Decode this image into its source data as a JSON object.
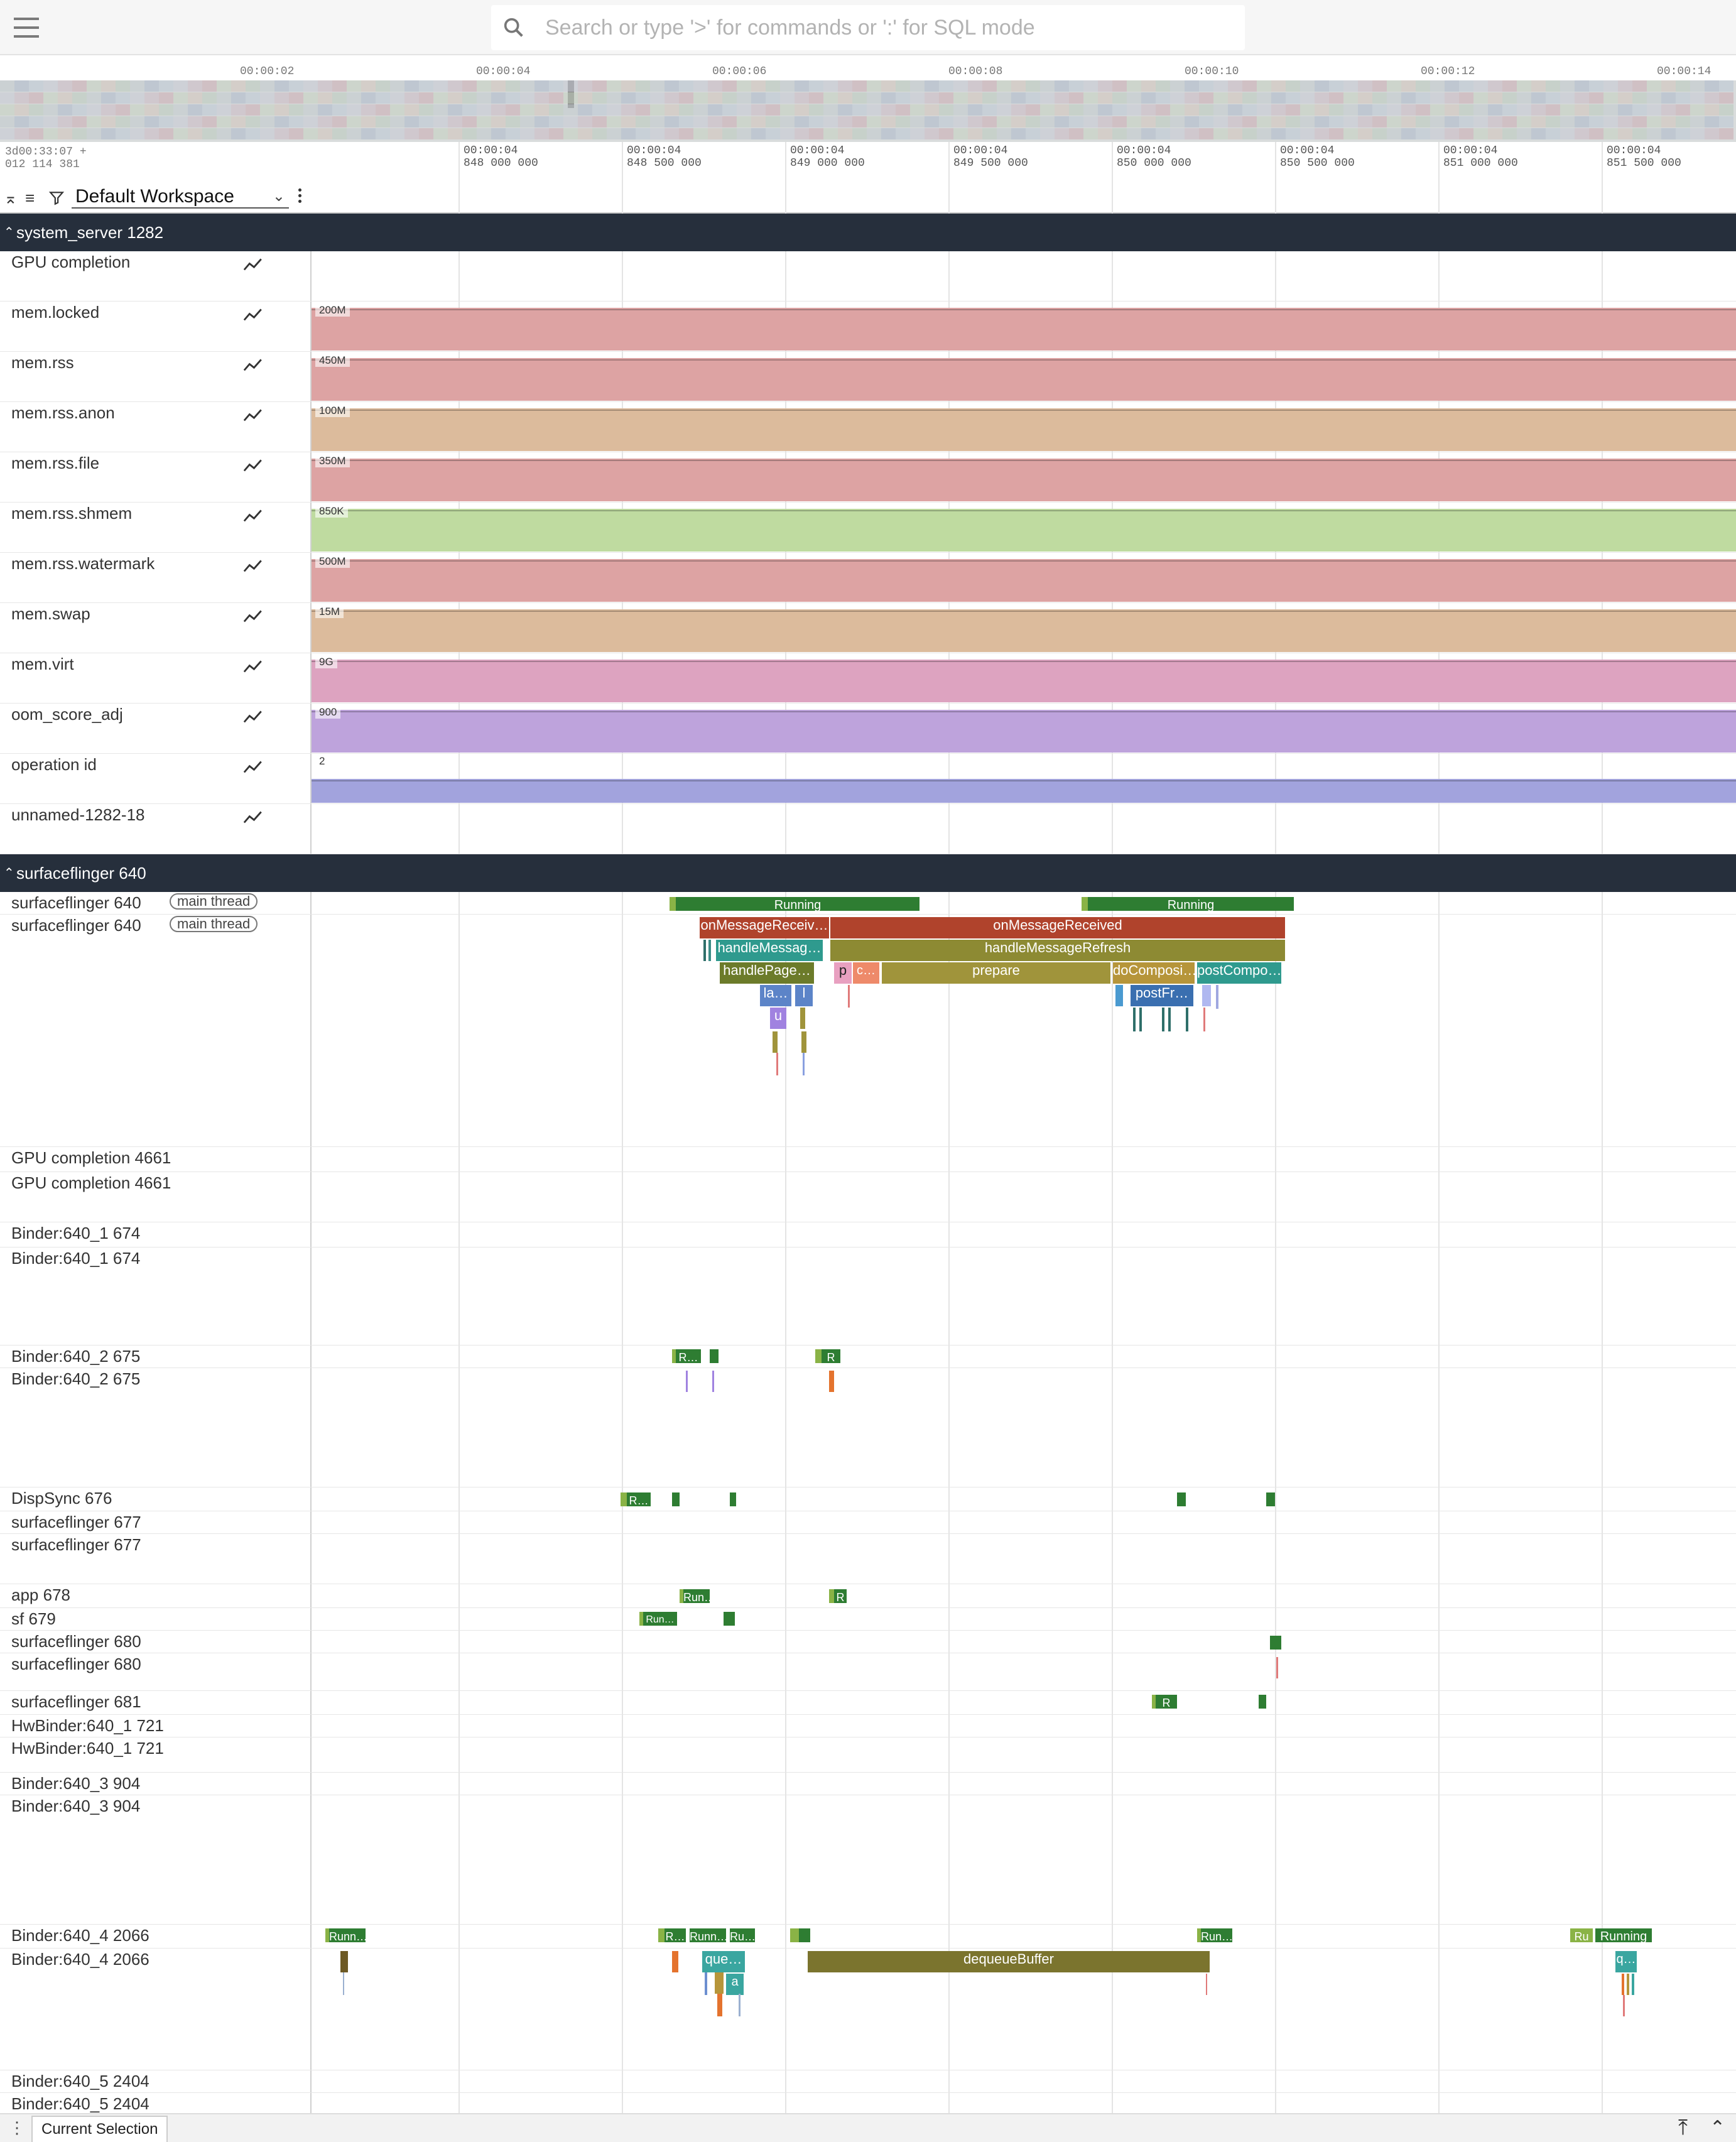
{
  "topbar": {
    "search_placeholder": "Search or type '>' for commands or ':' for SQL mode"
  },
  "timeline": {
    "ticks": [
      "00:00:02",
      "00:00:04",
      "00:00:06",
      "00:00:08",
      "00:00:10",
      "00:00:12",
      "00:00:14"
    ]
  },
  "header": {
    "timestamp_line1": "3d00:33:07 +",
    "timestamp_line2": "012 114 381",
    "workspace": "Default Workspace",
    "ticks": [
      {
        "l1": "00:00:04",
        "l2": "848 000 000"
      },
      {
        "l1": "00:00:04",
        "l2": "848 500 000"
      },
      {
        "l1": "00:00:04",
        "l2": "849 000 000"
      },
      {
        "l1": "00:00:04",
        "l2": "849 500 000"
      },
      {
        "l1": "00:00:04",
        "l2": "850 000 000"
      },
      {
        "l1": "00:00:04",
        "l2": "850 500 000"
      },
      {
        "l1": "00:00:04",
        "l2": "851 000 000"
      },
      {
        "l1": "00:00:04",
        "l2": "851 500 000"
      }
    ]
  },
  "groups": {
    "system_server": "system_server 1282",
    "surfaceflinger": "surfaceflinger 640"
  },
  "counters": [
    {
      "name": "GPU completion",
      "value": "",
      "color": ""
    },
    {
      "name": "mem.locked",
      "value": "200M",
      "color": "#dda3a3"
    },
    {
      "name": "mem.rss",
      "value": "450M",
      "color": "#dda3a3"
    },
    {
      "name": "mem.rss.anon",
      "value": "100M",
      "color": "#dcbb9c"
    },
    {
      "name": "mem.rss.file",
      "value": "350M",
      "color": "#dda3a3"
    },
    {
      "name": "mem.rss.shmem",
      "value": "850K",
      "color": "#bfdba0"
    },
    {
      "name": "mem.rss.watermark",
      "value": "500M",
      "color": "#dda3a3"
    },
    {
      "name": "mem.swap",
      "value": "15M",
      "color": "#dcbb9c"
    },
    {
      "name": "mem.virt",
      "value": "9G",
      "color": "#dda3c0"
    },
    {
      "name": "oom_score_adj",
      "value": "900",
      "color": "#bea3dc"
    },
    {
      "name": "operation id",
      "value": "2",
      "color": "#a2a3dd"
    },
    {
      "name": "unnamed-1282-18",
      "value": "",
      "color": ""
    }
  ],
  "threads": {
    "main_thread_chip": "main thread",
    "names": {
      "sf640": "surfaceflinger 640",
      "gpu4661": "GPU completion 4661",
      "b674": "Binder:640_1 674",
      "b675": "Binder:640_2 675",
      "dispsync": "DispSync 676",
      "sf677": "surfaceflinger 677",
      "app678": "app 678",
      "sf679": "sf 679",
      "sf680": "surfaceflinger 680",
      "sf681": "surfaceflinger 681",
      "hw721": "HwBinder:640_1 721",
      "b904": "Binder:640_3 904",
      "b2066": "Binder:640_4 2066",
      "b2404": "Binder:640_5 2404"
    }
  },
  "slices": {
    "running": "Running",
    "onMessageReceiv": "onMessageReceiv…",
    "onMessageReceived": "onMessageReceived",
    "handleMessag": "handleMessag…",
    "handleMessageRefresh": "handleMessageRefresh",
    "handlePage": "handlePage…",
    "p": "p",
    "c": "c…",
    "prepare": "prepare",
    "doComposi": "doComposi…",
    "postCompo": "postCompo…",
    "la": "la…",
    "l": "l",
    "u": "u",
    "postFr": "postFr…",
    "R": "R",
    "Rdots": "R…",
    "Run": "Run…",
    "Runn": "Runn…",
    "Ru": "Ru…",
    "Rud": "Ru",
    "que": "que…",
    "a": "a",
    "q": "q…",
    "dequeueBuffer": "dequeueBuffer"
  },
  "footer": {
    "current_selection": "Current Selection"
  },
  "colors": {
    "group_bg": "#262f3c",
    "running": "#2e7d32",
    "onMessage": "#b0432c",
    "handleMessageRefresh": "#8d8a33",
    "teal": "#2f9a8e",
    "olive": "#6c7b2a",
    "blue": "#5c84c8"
  }
}
